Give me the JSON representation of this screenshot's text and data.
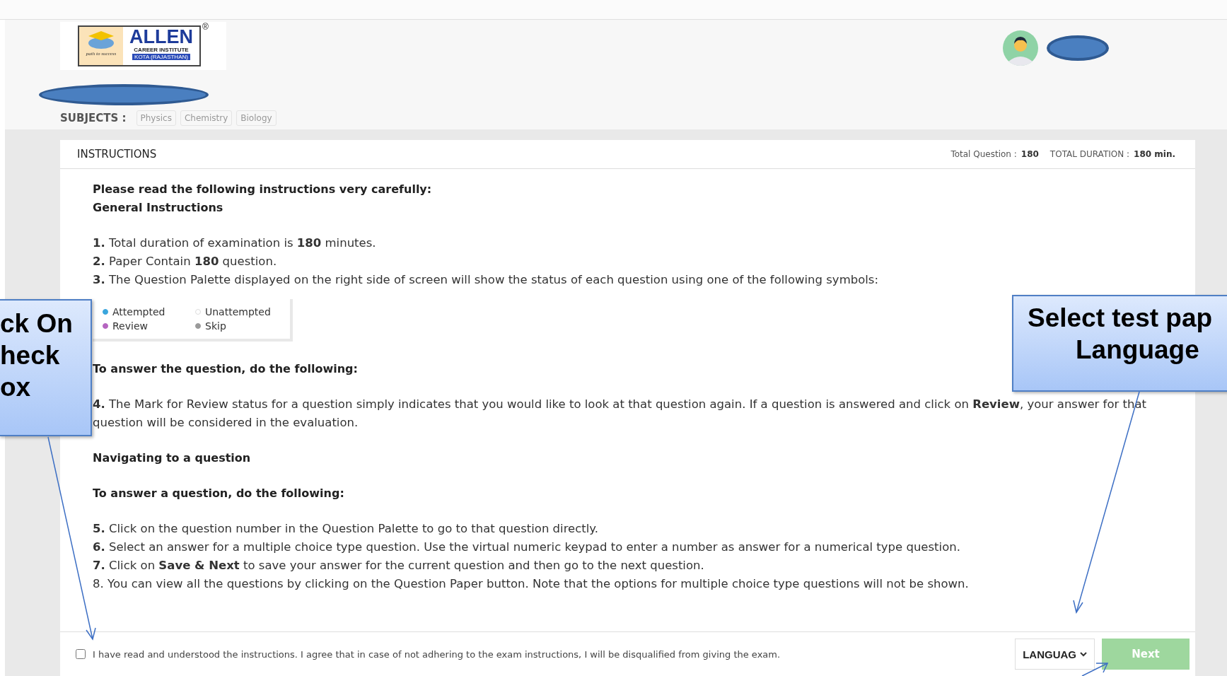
{
  "logo": {
    "name": "ALLEN",
    "line1": "CAREER INSTITUTE",
    "line2": "KOTA (RAJASTHAN)",
    "tagline": "path to success",
    "mark": "®"
  },
  "subjects": {
    "label": "SUBJECTS :",
    "items": [
      {
        "label": "Physics"
      },
      {
        "label": "Chemistry"
      },
      {
        "label": "Biology"
      }
    ]
  },
  "instructions": {
    "title": "INSTRUCTIONS",
    "total_question_label": "Total Question :",
    "total_question": "180",
    "total_duration_label": "TOTAL DURATION :",
    "total_duration": "180 min.",
    "sections": [
      {
        "kind": "lines",
        "lines": [
          {
            "kind": "heading",
            "text": "Please read the following instructions very carefully:"
          },
          {
            "kind": "heading",
            "text": "General Instructions"
          }
        ]
      },
      {
        "kind": "lines",
        "lines": [
          {
            "kind": "item",
            "text": "**1.** Total duration of examination is **180** minutes."
          },
          {
            "kind": "item",
            "text": "**2.** Paper Contain **180** question."
          },
          {
            "kind": "item",
            "text": "**3.** The Question Palette displayed on the right side of screen will show the status of each question using one of the following symbols:"
          }
        ]
      },
      {
        "kind": "legend",
        "items": [
          {
            "label": "Attempted",
            "color": "#3aa6dd",
            "kind": "filled"
          },
          {
            "label": "Unattempted",
            "color": "#dddddd",
            "kind": "outline"
          },
          {
            "label": "Review",
            "color": "#b565c0",
            "kind": "filled"
          },
          {
            "label": "Skip",
            "color": "#9a9a9a",
            "kind": "filled"
          }
        ]
      },
      {
        "kind": "lines",
        "lines": [
          {
            "kind": "heading",
            "text": "To answer the question, do the following:"
          }
        ]
      },
      {
        "kind": "lines",
        "lines": [
          {
            "kind": "item",
            "text": "**4.** The Mark for Review status for a question simply indicates that you would like to look at that question again. If a question is answered and click on **Review**, your answer for that question will be considered in the evaluation."
          }
        ]
      },
      {
        "kind": "lines",
        "lines": [
          {
            "kind": "heading",
            "text": "Navigating to a question"
          }
        ]
      },
      {
        "kind": "lines",
        "lines": [
          {
            "kind": "heading",
            "text": "To answer a question, do the following:"
          }
        ]
      },
      {
        "kind": "lines",
        "lines": [
          {
            "kind": "item",
            "text": "**5.** Click on the question number in the Question Palette to go to that question directly."
          },
          {
            "kind": "item",
            "text": "**6.** Select an answer for a multiple choice type question. Use the virtual numeric keypad to enter a number as answer for a numerical type question."
          },
          {
            "kind": "item",
            "text": "**7.** Click on **Save & Next** to save your answer for the current question and then go to the next question."
          },
          {
            "kind": "item",
            "text": "8. You can view all the questions by clicking on the Question Paper button. Note that the options for multiple choice type questions will not be shown."
          }
        ]
      }
    ]
  },
  "footer": {
    "agree_checked": false,
    "agree_text": "I have read and understood the instructions. I agree that in case of not adhering to the exam instructions, I will be disqualified from giving the exam.",
    "language": "LANGUAG",
    "next": {
      "label": "Next",
      "disabled": true
    }
  },
  "callouts": [
    {
      "lines": [
        "ck On",
        "heck",
        "ox"
      ]
    },
    {
      "lines": [
        "Select test pap",
        "Language"
      ]
    }
  ]
}
